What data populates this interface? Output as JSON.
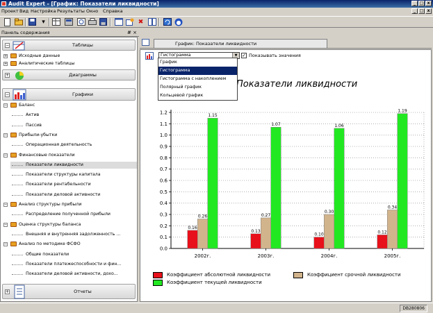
{
  "window": {
    "title": "Audit Expert - [График: Показатели ликвидности]",
    "controls": [
      "_",
      "□",
      "x"
    ]
  },
  "menu": [
    "Проект",
    "Вид",
    "Настройка",
    "Результаты",
    "Окно",
    "Справка"
  ],
  "panel": {
    "title": "Панель содержания",
    "buttons": "# ×",
    "groups": {
      "tables": "Таблицы",
      "diagrams": "Диаграммы",
      "graphs": "Графики",
      "reports": "Отчеты"
    },
    "tables_items": [
      "Исходные данные",
      "Аналитические таблицы"
    ],
    "graphs_tree": [
      {
        "label": "Баланс",
        "level": 0,
        "folder": true,
        "sign": "−"
      },
      {
        "label": "Актив",
        "level": 1
      },
      {
        "label": "Пассив",
        "level": 1
      },
      {
        "label": "Прибыли-убытки",
        "level": 0,
        "folder": true,
        "sign": "−"
      },
      {
        "label": "Операционная деятельность",
        "level": 1
      },
      {
        "label": "Финансовые показатели",
        "level": 0,
        "folder": true,
        "sign": "−"
      },
      {
        "label": "Показатели ликвидности",
        "level": 1,
        "selected": true
      },
      {
        "label": "Показатели структуры капитала",
        "level": 1
      },
      {
        "label": "Показатели рентабельности",
        "level": 1
      },
      {
        "label": "Показатели деловой активности",
        "level": 1
      },
      {
        "label": "Анализ структуры прибыли",
        "level": 0,
        "folder": true,
        "sign": "−"
      },
      {
        "label": "Распределение полученной прибыли",
        "level": 1
      },
      {
        "label": "Оценка структуры баланса",
        "level": 0,
        "folder": true,
        "sign": "−"
      },
      {
        "label": "Внешняя и внутренняя задолженность ...",
        "level": 1
      },
      {
        "label": "Анализ по методике ФСФО",
        "level": 0,
        "folder": true,
        "sign": "−"
      },
      {
        "label": "Общие показатели",
        "level": 1
      },
      {
        "label": "Показатели платежеспособности и фин...",
        "level": 1
      },
      {
        "label": "Показатели деловой активности, дохо...",
        "level": 1
      }
    ]
  },
  "doc_tab": {
    "title": "График: Показатели ликвидности"
  },
  "controls": {
    "chart_type_value": "Гистограмма",
    "show_values_label": "Показывать значения",
    "show_values_checked": "✓",
    "dropdown_options": [
      "График",
      "Гистограмма",
      "Гистограмма с накоплением",
      "Полярный график",
      "Кольцевой график"
    ],
    "dropdown_selected_index": 1
  },
  "chart_data": {
    "type": "bar",
    "title": "Показатели ликвидности",
    "title_visible": "Показатели ликвидности",
    "categories": [
      "2002г.",
      "2003г.",
      "2004г.",
      "2005г."
    ],
    "series": [
      {
        "name": "Коэффициент абсолютной ликвидности",
        "color": "#e8101a",
        "values": [
          0.16,
          0.13,
          0.1,
          0.12
        ]
      },
      {
        "name": "Коэффициент срочной ликвидности",
        "color": "#d2b48c",
        "values": [
          0.26,
          0.27,
          0.3,
          0.34
        ]
      },
      {
        "name": "Коэффициент текущей ликвидности",
        "color": "#22e822",
        "values": [
          1.15,
          1.07,
          1.06,
          1.19
        ]
      }
    ],
    "value_labels": [
      [
        "0.16",
        "0.13",
        "0.10",
        "0.12"
      ],
      [
        "0.26",
        "0.27",
        "0.30",
        "0.34"
      ],
      [
        "1.15",
        "1.07",
        "1.06",
        "1.19"
      ]
    ],
    "yticks": [
      "0.0",
      "0.1",
      "0.2",
      "0.3",
      "0.4",
      "0.5",
      "0.6",
      "0.7",
      "0.8",
      "0.9",
      "1.0",
      "1.1",
      "1.2"
    ],
    "ylim": [
      0,
      1.2
    ],
    "grid": true,
    "legend_position": "bottom"
  },
  "status": {
    "text": "DB280806"
  }
}
